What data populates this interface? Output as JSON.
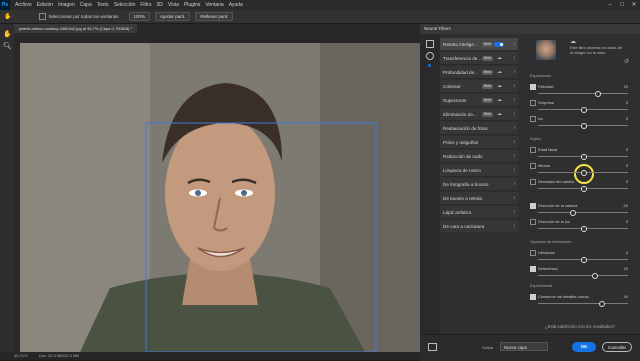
{
  "menubar": {
    "logo": "Ps",
    "items": [
      "Archivo",
      "Edición",
      "Imagen",
      "Capa",
      "Texto",
      "Selección",
      "Filtro",
      "3D",
      "Vista",
      "Plugins",
      "Ventana",
      "Ayuda"
    ]
  },
  "options_bar": {
    "sample_all_layers": "Seleccionar por todas las ventanas",
    "zoom_pct": "100%",
    "fit_screen": "Ajustar pant.",
    "fill_screen": "Rellenar pant."
  },
  "document": {
    "tab_title": "peterb-nelson-cowboy-1580442.jpg al 45,7% (Capa 0, RGB/8) *",
    "status_zoom": "45,71%",
    "status_info": "Doc: 32,4 MB/32,4 MB"
  },
  "panel": {
    "title": "Neural Filters",
    "filters": [
      {
        "label": "Retrato intelige...",
        "beta": "Beta",
        "state": "on"
      },
      {
        "label": "Transferencia de...",
        "beta": "Beta",
        "state": "cloud"
      },
      {
        "label": "Profundidad de...",
        "beta": "Beta",
        "state": "cloud"
      },
      {
        "label": "Colorear",
        "beta": "Beta",
        "state": "cloud"
      },
      {
        "label": "Superzoom",
        "beta": "Beta",
        "state": "cloud"
      },
      {
        "label": "Eliminación de...",
        "beta": "Beta",
        "state": "cloud"
      },
      {
        "label": "Restauración de fotos",
        "beta": "",
        "state": ""
      },
      {
        "label": "Polvo y rasguños",
        "beta": "",
        "state": ""
      },
      {
        "label": "Reducción de ruido",
        "beta": "",
        "state": ""
      },
      {
        "label": "Limpieza de rostro",
        "beta": "",
        "state": ""
      },
      {
        "label": "De fotografía a boceto",
        "beta": "",
        "state": ""
      },
      {
        "label": "De boceto a retrato",
        "beta": "",
        "state": ""
      },
      {
        "label": "Lápiz artístico",
        "beta": "",
        "state": ""
      },
      {
        "label": "De cara a caricatura",
        "beta": "",
        "state": ""
      }
    ],
    "description": "Este filtro procesa los datos de la imagen en la nube.",
    "sections": {
      "expressions": "Expresiones",
      "subject": "Sujeto",
      "lighting": "Opciones de iluminación",
      "experimental": "Experimental"
    },
    "sliders": [
      {
        "label": "Felicidad",
        "value": "20",
        "checked": true,
        "pos": 0.65
      },
      {
        "label": "Sorpresa",
        "value": "0",
        "checked": false,
        "pos": 0.5
      },
      {
        "label": "Ira",
        "value": "0",
        "checked": false,
        "pos": 0.5
      },
      {
        "label": "Edad facial",
        "value": "0",
        "checked": false,
        "pos": 0.5
      },
      {
        "label": "Mirada",
        "value": "0",
        "checked": false,
        "pos": 0.5
      },
      {
        "label": "Densidad del cabello",
        "value": "0",
        "checked": false,
        "pos": 0.5
      },
      {
        "label": "Dirección de la cabeza",
        "value": "-20",
        "checked": true,
        "pos": 0.38
      },
      {
        "label": "Dirección de la luz",
        "value": "0",
        "checked": false,
        "pos": 0.5
      },
      {
        "label": "Ubicación",
        "value": "0",
        "checked": false,
        "pos": 0.5
      },
      {
        "label": "Desenfocar",
        "value": "20",
        "checked": true,
        "pos": 0.62
      },
      {
        "label": "Conservar los detalles únicos",
        "value": "40",
        "checked": true,
        "pos": 0.7
      }
    ],
    "satisfied_text": "¿Está satisfecho con los resultados?",
    "output_label": "Salida",
    "output_value": "Nueva capa",
    "ok_label": "OK",
    "cancel_label": "Cancelar"
  }
}
